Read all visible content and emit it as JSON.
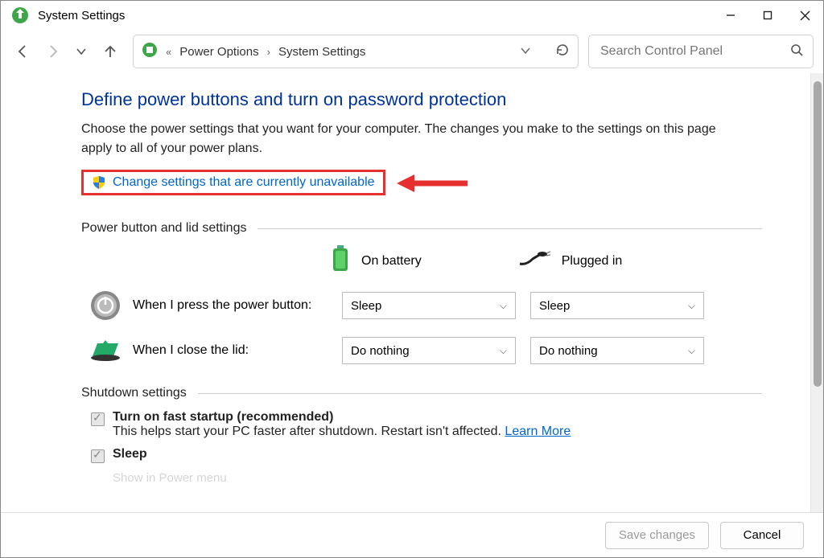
{
  "window": {
    "title": "System Settings"
  },
  "breadcrumb": {
    "sep": "«",
    "item1": "Power Options",
    "item2": "System Settings"
  },
  "search": {
    "placeholder": "Search Control Panel"
  },
  "page": {
    "heading": "Define power buttons and turn on password protection",
    "description": "Choose the power settings that you want for your computer. The changes you make to the settings on this page apply to all of your power plans.",
    "change_link": "Change settings that are currently unavailable"
  },
  "section1": {
    "title": "Power button and lid settings",
    "col_battery": "On battery",
    "col_plugged": "Plugged in",
    "rows": [
      {
        "label": "When I press the power button:",
        "battery": "Sleep",
        "plugged": "Sleep"
      },
      {
        "label": "When I close the lid:",
        "battery": "Do nothing",
        "plugged": "Do nothing"
      }
    ]
  },
  "section2": {
    "title": "Shutdown settings",
    "items": [
      {
        "label": "Turn on fast startup (recommended)",
        "sub": "This helps start your PC faster after shutdown. Restart isn't affected. ",
        "learn": "Learn More"
      },
      {
        "label": "Sleep",
        "sub_cut": "Show in Power menu"
      }
    ]
  },
  "footer": {
    "save": "Save changes",
    "cancel": "Cancel"
  }
}
